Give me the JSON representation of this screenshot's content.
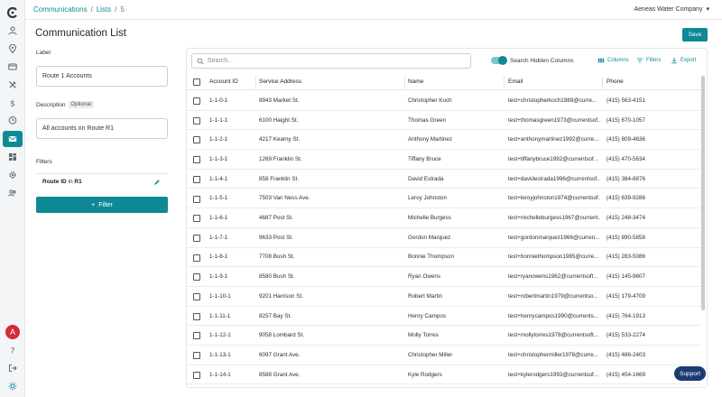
{
  "breadcrumb": {
    "root": "Communications",
    "sep1": "/",
    "section": "Lists",
    "sep2": "/",
    "id": "5"
  },
  "header": {
    "company": "Aeneas Water Company",
    "caret": "▾"
  },
  "page": {
    "title": "Communication List",
    "save_label": "Save"
  },
  "form": {
    "label_title": "Label",
    "label_value": "Route 1 Accounts",
    "description_title": "Description",
    "optional_badge": "Optional",
    "description_value": "All accounts on Route R1",
    "filters_title": "Filters",
    "filter": {
      "field": "Route ID",
      "op": "in",
      "value": "R1"
    },
    "add_filter_label": "Filter"
  },
  "table": {
    "search_placeholder": "Search...",
    "toggle_label": "Search Hidden Columns",
    "columns_label": "Columns",
    "filters_label": "Filters",
    "export_label": "Export",
    "headers": [
      "Account ID",
      "Service Address",
      "Name",
      "Email",
      "Phone"
    ],
    "rows": [
      [
        "1-1-0-1",
        "8943 Market St.",
        "Christopher Koch",
        "test+christopherkoch1989@curre...",
        "(415) 563-4151"
      ],
      [
        "1-1-1-1",
        "6100 Haight St.",
        "Thomas Green",
        "test+thomasgreen1973@currentsof...",
        "(415) 670-1057"
      ],
      [
        "1-1-2-1",
        "4217 Kearny St.",
        "Anthony Martinez",
        "test+anthonymartinez1992@curre...",
        "(415) 809-4636"
      ],
      [
        "1-1-3-1",
        "1269 Franklin St.",
        "Tiffany Bruce",
        "test+tiffanybruce1992@currentsof...",
        "(415) 470-5634"
      ],
      [
        "1-1-4-1",
        "858 Franklin St.",
        "David Estrada",
        "test+davidestrada1996@currentsof...",
        "(415) 384-8876"
      ],
      [
        "1-1-5-1",
        "7503 Van Ness Ave.",
        "Leroy Johnston",
        "test+leroyjohnston1974@currentsof...",
        "(415) 639-9286"
      ],
      [
        "1-1-6-1",
        "4687 Post St.",
        "Michelle Burgess",
        "test+michelleburgess1967@current...",
        "(415) 248-3474"
      ],
      [
        "1-1-7-1",
        "9633 Post St.",
        "Gordon Marquez",
        "test+gordonmarquez1966@curren...",
        "(415) 890-5858"
      ],
      [
        "1-1-8-1",
        "7708 Bush St.",
        "Bonnie Thompson",
        "test+bonniethompson1985@curre...",
        "(415) 283-5086"
      ],
      [
        "1-1-9-1",
        "8580 Bush St.",
        "Ryan Owens",
        "test+ryanowens1962@currentsoft...",
        "(415) 145-9607"
      ],
      [
        "1-1-10-1",
        "9201 Harrison St.",
        "Robert Martin",
        "test+robertmartin1979@currentso...",
        "(415) 179-4709"
      ],
      [
        "1-1-11-1",
        "8257 Bay St.",
        "Henry Campos",
        "test+henrycampos1990@currents...",
        "(415) 764-1913"
      ],
      [
        "1-1-12-1",
        "9058 Lombard St.",
        "Molly Torres",
        "test+mollytorres1978@currentsoft...",
        "(415) 533-2274"
      ],
      [
        "1-1-13-1",
        "6097 Grant Ave.",
        "Christopher Miller",
        "test+christophermiller1978@curre...",
        "(415) 486-2403"
      ],
      [
        "1-1-14-1",
        "8588 Grant Ave.",
        "Kyle Rodgers",
        "test+kylerodgers1993@currentsof...",
        "(415) 454-1669"
      ]
    ]
  },
  "user": {
    "avatar_initial": "A"
  },
  "support_label": "Support",
  "colors": {
    "accent": "#0f8a94",
    "support": "#1d3b73",
    "avatar": "#d62b3a"
  }
}
